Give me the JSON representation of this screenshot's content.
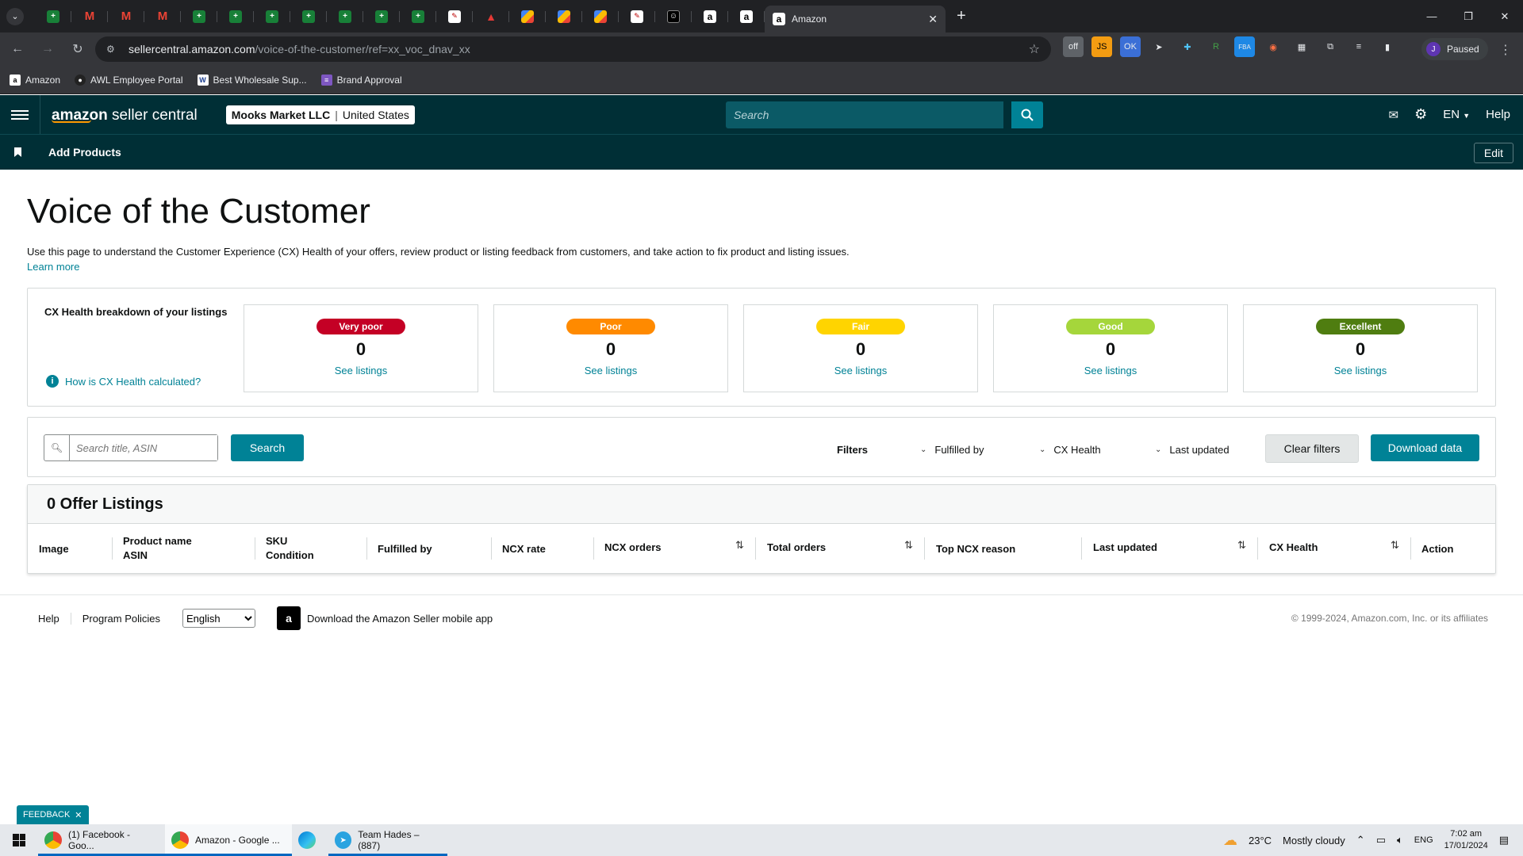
{
  "browser": {
    "active_tab_title": "Amazon",
    "url_host": "sellercentral.amazon.com",
    "url_path": "/voice-of-the-customer/ref=xx_voc_dnav_xx",
    "profile_initial": "J",
    "profile_status": "Paused",
    "pinned_tabs": [
      {
        "icon": "sheets-icon",
        "glyph": "+"
      },
      {
        "icon": "gmail-icon",
        "glyph": "M"
      },
      {
        "icon": "gmail-icon",
        "glyph": "M"
      },
      {
        "icon": "gmail-icon",
        "glyph": "M"
      },
      {
        "icon": "sheets-icon",
        "glyph": "+"
      },
      {
        "icon": "sheets-icon",
        "glyph": "+"
      },
      {
        "icon": "sheets-icon",
        "glyph": "+"
      },
      {
        "icon": "sheets-icon",
        "glyph": "+"
      },
      {
        "icon": "sheets-icon",
        "glyph": "+"
      },
      {
        "icon": "sheets-icon",
        "glyph": "+"
      },
      {
        "icon": "sheets-icon",
        "glyph": "+"
      },
      {
        "icon": "photo-icon",
        "glyph": "✎"
      },
      {
        "icon": "red-logo-icon",
        "glyph": "▲"
      },
      {
        "icon": "multicolor-icon",
        "glyph": ""
      },
      {
        "icon": "multicolor-icon",
        "glyph": ""
      },
      {
        "icon": "multicolor-icon",
        "glyph": ""
      },
      {
        "icon": "photo-icon",
        "glyph": "✎"
      },
      {
        "icon": "black-logo-icon",
        "glyph": "☺"
      },
      {
        "icon": "amazon-icon",
        "glyph": "a"
      },
      {
        "icon": "amazon-icon",
        "glyph": "a"
      }
    ],
    "bookmarks": [
      {
        "label": "Amazon",
        "icon": "amazon-icon"
      },
      {
        "label": "AWL Employee Portal",
        "icon": "portal-icon"
      },
      {
        "label": "Best Wholesale Sup...",
        "icon": "wc-icon"
      },
      {
        "label": "Brand Approval",
        "icon": "list-icon"
      }
    ]
  },
  "header": {
    "logo_amazon": "amazon",
    "logo_rest": " seller central",
    "merchant_name": "Mooks Market LLC",
    "marketplace": "United States",
    "search_placeholder": "Search",
    "language": "EN",
    "help": "Help"
  },
  "subnav": {
    "link": "Add Products",
    "edit": "Edit"
  },
  "page": {
    "title": "Voice of the Customer",
    "description": "Use this page to understand the Customer Experience (CX) Health of your offers, review product or listing feedback from customers, and take action to fix product and listing issues.",
    "learn_more": "Learn more"
  },
  "cx_health": {
    "label": "CX Health breakdown of your listings",
    "info_link": "How is CX Health calculated?",
    "cards": [
      {
        "badge": "Very poor",
        "count": "0",
        "link": "See listings",
        "color": "#c40025",
        "text_color": "#ffffff"
      },
      {
        "badge": "Poor",
        "count": "0",
        "link": "See listings",
        "color": "#ff8a00",
        "text_color": "#ffffff"
      },
      {
        "badge": "Fair",
        "count": "0",
        "link": "See listings",
        "color": "#ffd400",
        "text_color": "#ffffff"
      },
      {
        "badge": "Good",
        "count": "0",
        "link": "See listings",
        "color": "#a5d63b",
        "text_color": "#ffffff"
      },
      {
        "badge": "Excellent",
        "count": "0",
        "link": "See listings",
        "color": "#4f7d10",
        "text_color": "#ffffff"
      }
    ]
  },
  "filters": {
    "search_placeholder": "Search title, ASIN",
    "search_button": "Search",
    "label": "Filters",
    "fulfilled_by": "Fulfilled by",
    "cx_health": "CX Health",
    "last_updated": "Last updated",
    "clear": "Clear filters",
    "download": "Download data"
  },
  "listings": {
    "heading": "0 Offer Listings",
    "columns": {
      "image": "Image",
      "product_name": "Product name",
      "asin": "ASIN",
      "sku": "SKU",
      "condition": "Condition",
      "fulfilled_by": "Fulfilled by",
      "ncx_rate": "NCX rate",
      "ncx_orders": "NCX orders",
      "total_orders": "Total orders",
      "top_ncx_reason": "Top NCX reason",
      "last_updated": "Last updated",
      "cx_health": "CX Health",
      "action": "Action"
    }
  },
  "footer": {
    "help": "Help",
    "program_policies": "Program Policies",
    "language": "English",
    "app_download": "Download the Amazon Seller mobile app",
    "copyright": "© 1999-2024, Amazon.com, Inc. or its affiliates"
  },
  "feedback": {
    "label": "FEEDBACK"
  },
  "taskbar": {
    "apps": [
      {
        "label": "(1) Facebook - Goo..."
      },
      {
        "label": "Amazon - Google ..."
      },
      {
        "label": ""
      },
      {
        "label": "Team Hades – (887)"
      }
    ],
    "weather_temp": "23°C",
    "weather_desc": "Mostly cloudy",
    "lang": "ENG",
    "time": "7:02 am",
    "date": "17/01/2024"
  }
}
